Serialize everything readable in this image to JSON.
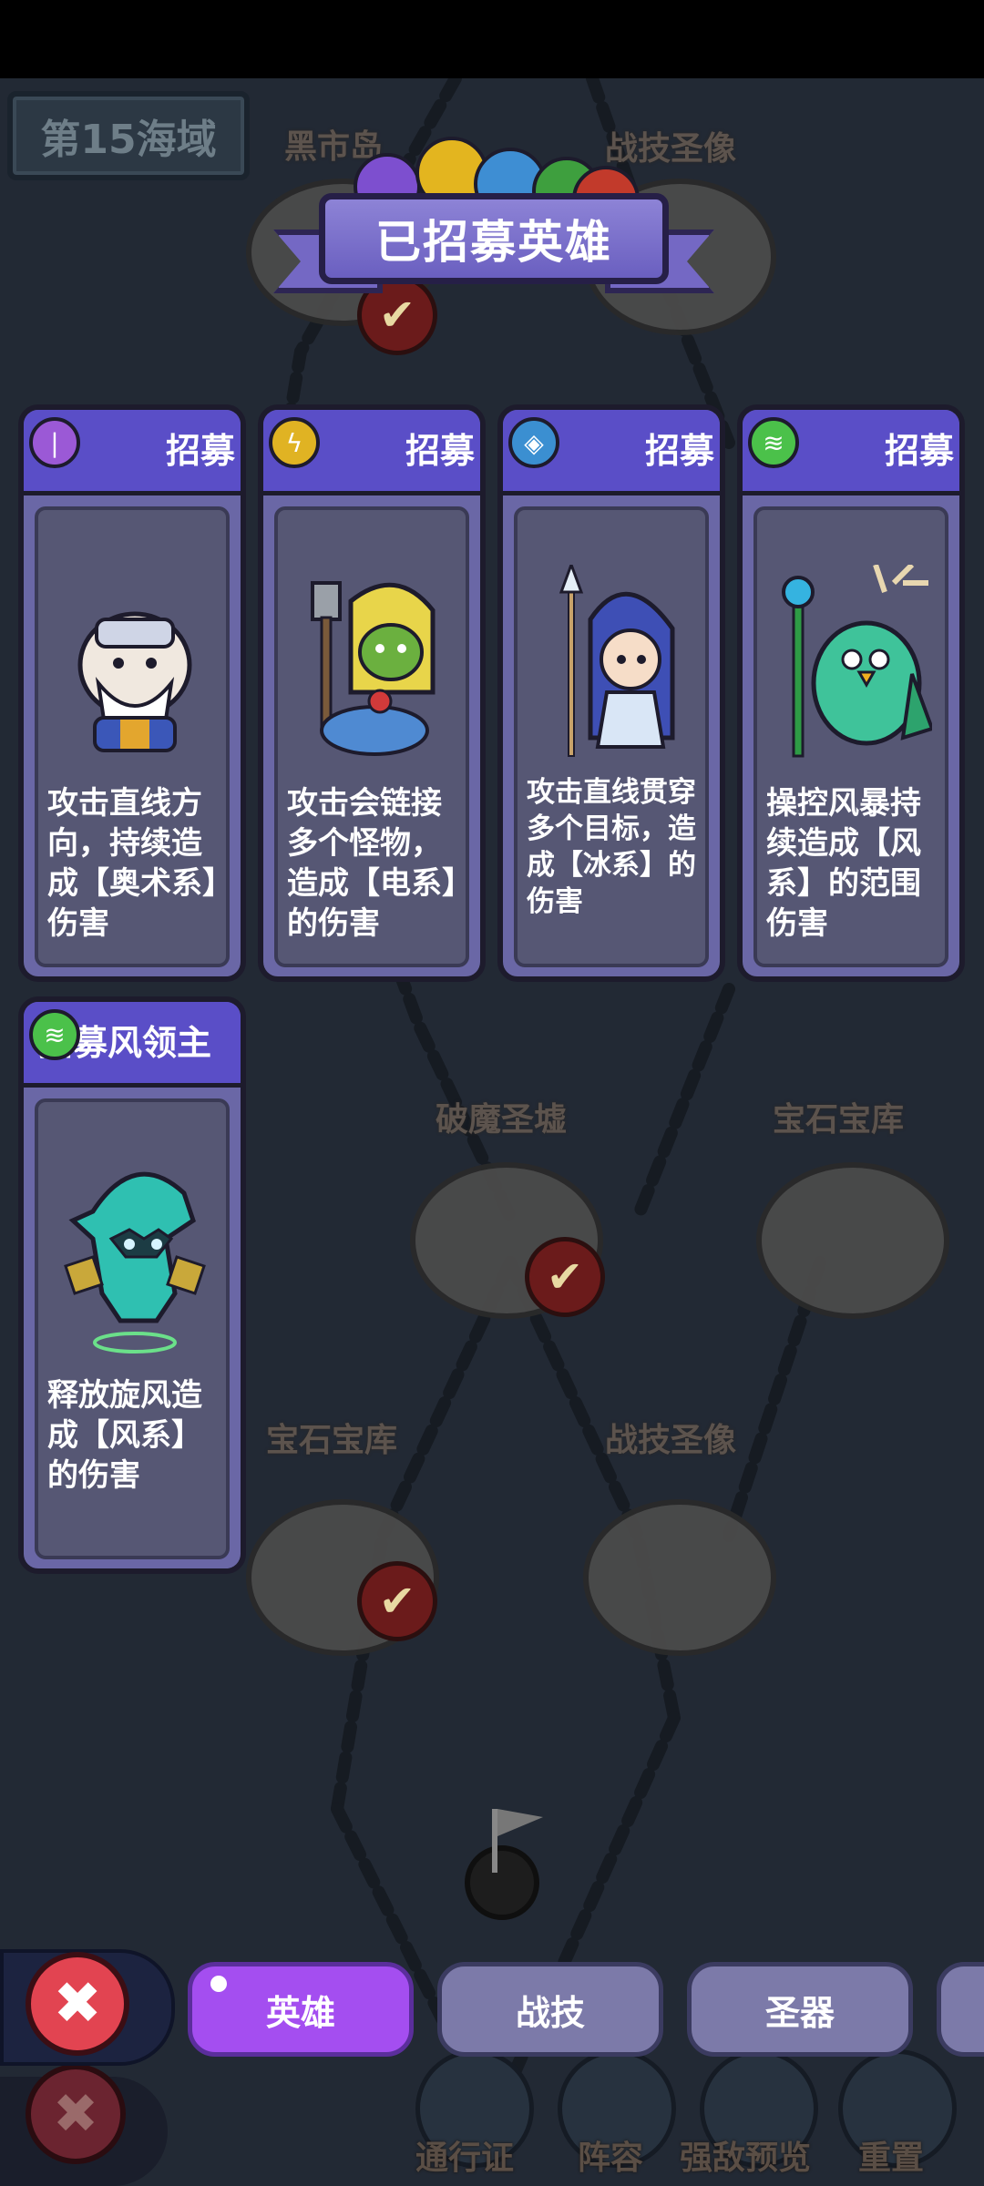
{
  "topbar": {},
  "sea_label": "第15海域",
  "map_nodes": [
    {
      "label": "黑市岛"
    },
    {
      "label": "战技圣像"
    },
    {
      "label": "破魔圣墟"
    },
    {
      "label": "宝石宝库"
    },
    {
      "label": "宝石宝库"
    },
    {
      "label": "战技圣像"
    }
  ],
  "title": "已招募英雄",
  "cards": [
    {
      "head": "招募",
      "element": "arcane",
      "element_color": "#9b59d6",
      "description": "攻击直线方向，持续造成【奥术系】伤害"
    },
    {
      "head": "招募",
      "element": "electric",
      "element_color": "#e0b323",
      "description": "攻击会链接多个怪物，造成【电系】的伤害"
    },
    {
      "head": "招募",
      "element": "ice",
      "element_color": "#3b8fd1",
      "description": "攻击直线贯穿多个目标，造成【冰系】的伤害"
    },
    {
      "head": "招募",
      "element": "wind",
      "element_color": "#4bc14a",
      "description": "操控风暴持续造成【风系】的范围伤害"
    },
    {
      "head": "招募风领主",
      "element": "wind",
      "element_color": "#4bc14a",
      "description": "释放旋风造成【风系】的伤害"
    }
  ],
  "tabs": [
    {
      "label": "英雄",
      "active": true
    },
    {
      "label": "战技",
      "active": false
    },
    {
      "label": "圣器",
      "active": false
    }
  ],
  "under_nav": [
    "通行证",
    "阵容",
    "强敌预览",
    "重置"
  ],
  "colors": {
    "accent": "#a44ef0",
    "card_head": "#5a4ec7",
    "close": "#e24451"
  }
}
